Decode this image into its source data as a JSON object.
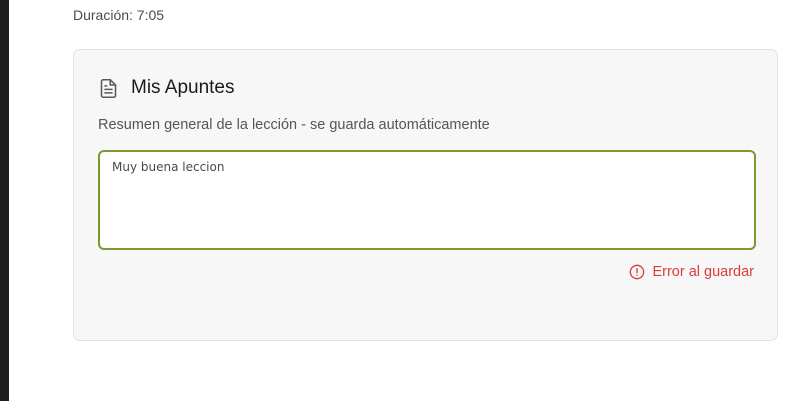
{
  "lesson": {
    "duration_text": "Duración: 7:05"
  },
  "notes_card": {
    "icon": "document-icon",
    "title": "Mis Apuntes",
    "description": "Resumen general de la lección - se guarda automáticamente",
    "textarea_value": "Muy buena leccion",
    "status_icon": "alert-circle-icon",
    "status_text": "Error al guardar"
  },
  "colors": {
    "accent_border": "#7a9a2a",
    "error": "#dc3b3b",
    "card_background": "#f7f7f7"
  }
}
